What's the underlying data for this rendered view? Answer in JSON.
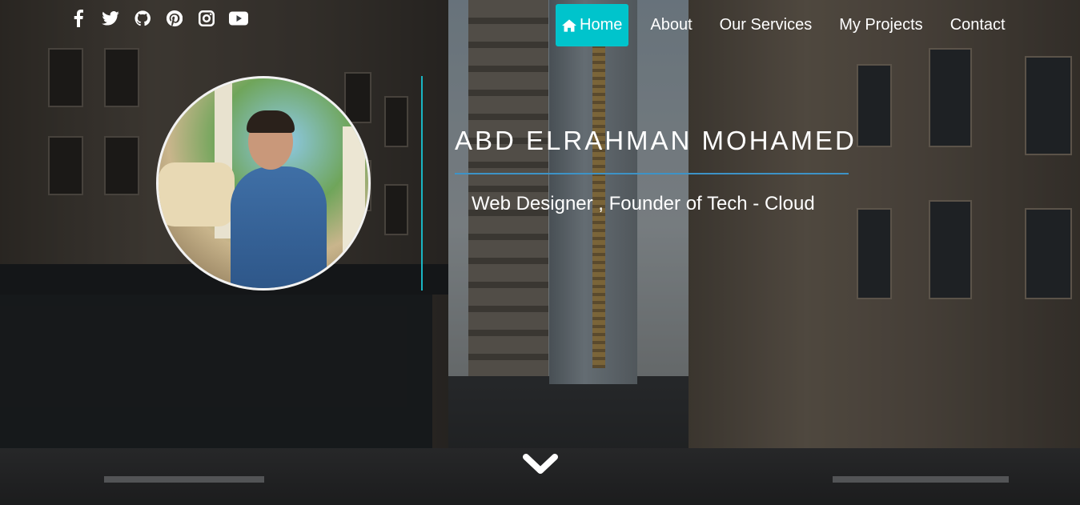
{
  "social": {
    "items": [
      {
        "icon": "facebook-icon"
      },
      {
        "icon": "twitter-icon"
      },
      {
        "icon": "github-icon"
      },
      {
        "icon": "pinterest-icon"
      },
      {
        "icon": "instagram-icon"
      },
      {
        "icon": "youtube-icon"
      }
    ]
  },
  "nav": {
    "home_icon": "home-icon",
    "items": [
      {
        "label": "Home",
        "active": true
      },
      {
        "label": "About",
        "active": false
      },
      {
        "label": "Our Services",
        "active": false
      },
      {
        "label": "My Projects",
        "active": false
      },
      {
        "label": "Contact",
        "active": false
      }
    ]
  },
  "hero": {
    "name": "ABD ELRAHMAN MOHAMED",
    "tagline": "Web Designer , Founder of Tech - Cloud",
    "scroll_icon": "chevron-down-icon"
  },
  "colors": {
    "accent": "#00c4cc",
    "divider_vertical": "#19b6c4",
    "divider_horizontal": "#3d93c7",
    "text": "#ffffff"
  }
}
